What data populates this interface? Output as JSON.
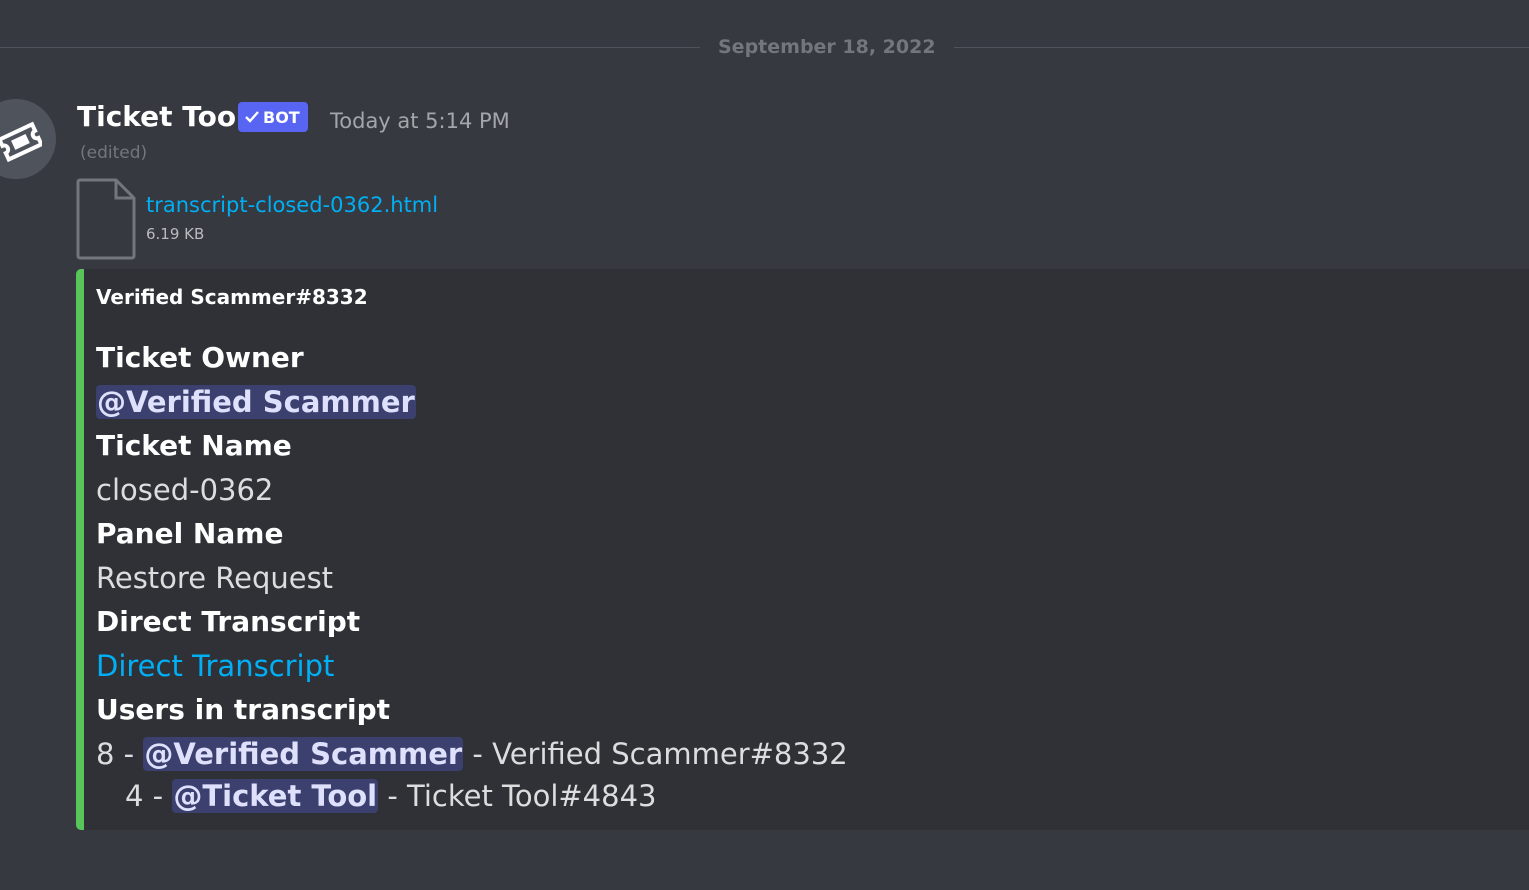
{
  "divider": {
    "date": "September 18, 2022"
  },
  "message": {
    "author": "Ticket Tool",
    "bot_tag": "BOT",
    "timestamp": "Today at 5:14 PM",
    "edited": "(edited)"
  },
  "attachment": {
    "filename": "transcript-closed-0362.html",
    "size": "6.19 KB"
  },
  "embed": {
    "accent_color": "#57c55a",
    "author": "Verified Scammer#8332",
    "fields": {
      "owner_title": "Ticket Owner",
      "owner_value": "@Verified Scammer",
      "name_title": "Ticket Name",
      "name_value": "closed-0362",
      "panel_title": "Panel Name",
      "panel_value": "Restore Request",
      "transcript_title": "Direct Transcript",
      "transcript_value": "Direct Transcript",
      "users_title": "Users in transcript"
    },
    "users": [
      {
        "count": "8 - ",
        "mention": "@Verified Scammer",
        "tag": " - Verified Scammer#8332"
      },
      {
        "count": "4 - ",
        "mention": "@Ticket Tool",
        "tag": " - Ticket Tool#4843"
      }
    ]
  },
  "icons": {
    "avatar": "ticket-icon",
    "attachment": "file-icon",
    "verified": "checkmark-icon"
  }
}
